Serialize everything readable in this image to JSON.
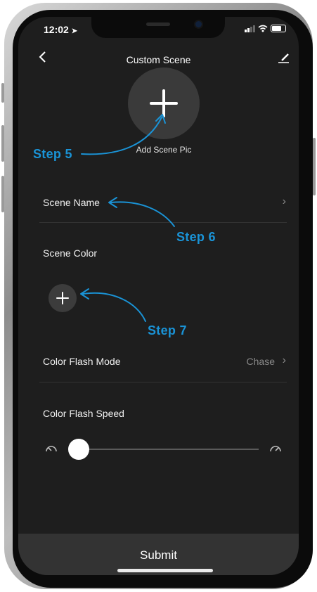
{
  "status_bar": {
    "time": "12:02"
  },
  "nav": {
    "title": "Custom Scene"
  },
  "scene_pic": {
    "caption": "Add Scene Pic"
  },
  "scene_name": {
    "label": "Scene Name"
  },
  "scene_color": {
    "label": "Scene Color"
  },
  "color_flash_mode": {
    "label": "Color Flash Mode",
    "value": "Chase"
  },
  "color_flash_speed": {
    "label": "Color Flash Speed",
    "level": 0.0
  },
  "submit": {
    "label": "Submit"
  },
  "annotations": {
    "step5": "Step 5",
    "step6": "Step 6",
    "step7": "Step 7"
  },
  "colors": {
    "accent_annotation": "#1a93d6",
    "screen_bg": "#1e1e1e",
    "submit_bar": "#333333"
  },
  "icons": [
    "location-arrow-icon",
    "signal-icon",
    "wifi-icon",
    "battery-icon",
    "back-icon",
    "edit-icon",
    "plus-icon",
    "chevron-right-icon",
    "slow-speed-icon",
    "fast-speed-icon"
  ]
}
